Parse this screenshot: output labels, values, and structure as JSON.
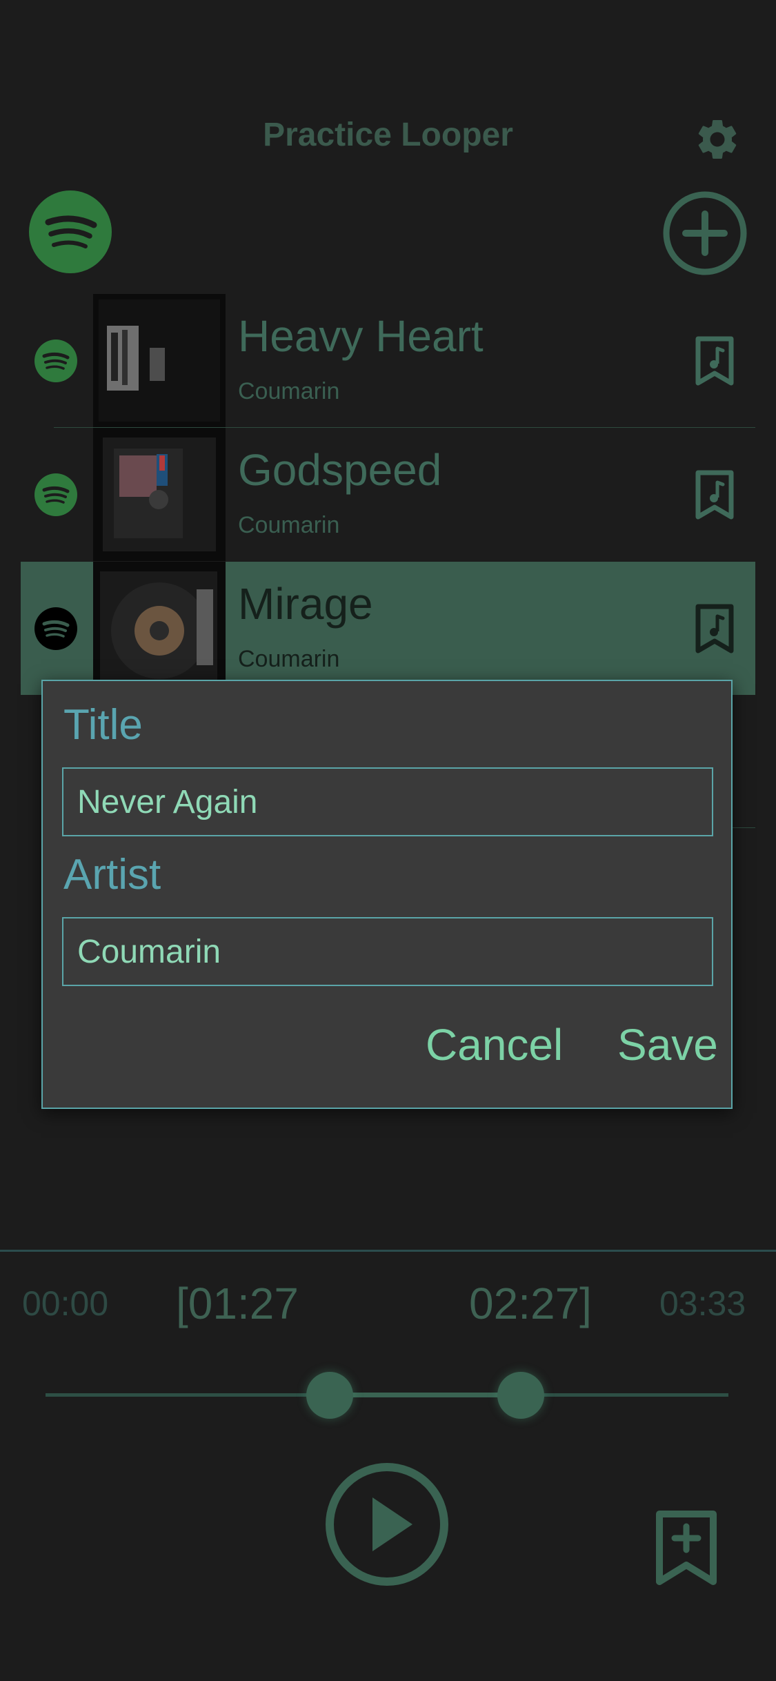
{
  "header": {
    "title": "Practice Looper"
  },
  "songs": [
    {
      "title": "Heavy Heart",
      "artist": "Coumarin",
      "selected": false
    },
    {
      "title": "Godspeed",
      "artist": "Coumarin",
      "selected": false
    },
    {
      "title": "Mirage",
      "artist": "Coumarin",
      "selected": true
    }
  ],
  "dialog": {
    "title_label": "Title",
    "title_value": "Never Again",
    "artist_label": "Artist",
    "artist_value": "Coumarin",
    "cancel_label": "Cancel",
    "save_label": "Save"
  },
  "player": {
    "start_time": "00:00",
    "loop_start": "[01:27",
    "loop_end": "02:27]",
    "end_time": "03:33"
  },
  "icons": {
    "settings": "gear-icon",
    "spotify": "spotify-icon",
    "add": "plus-circle-icon",
    "bookmark": "bookmark-music-icon",
    "play": "play-circle-icon",
    "add_bookmark": "bookmark-plus-icon"
  },
  "colors": {
    "background": "#1c1c1c",
    "accent": "#3a5d4e",
    "dialog_bg": "#3a3a3a",
    "dialog_border": "#5aa5a8",
    "button_text": "#7cd2a6"
  }
}
